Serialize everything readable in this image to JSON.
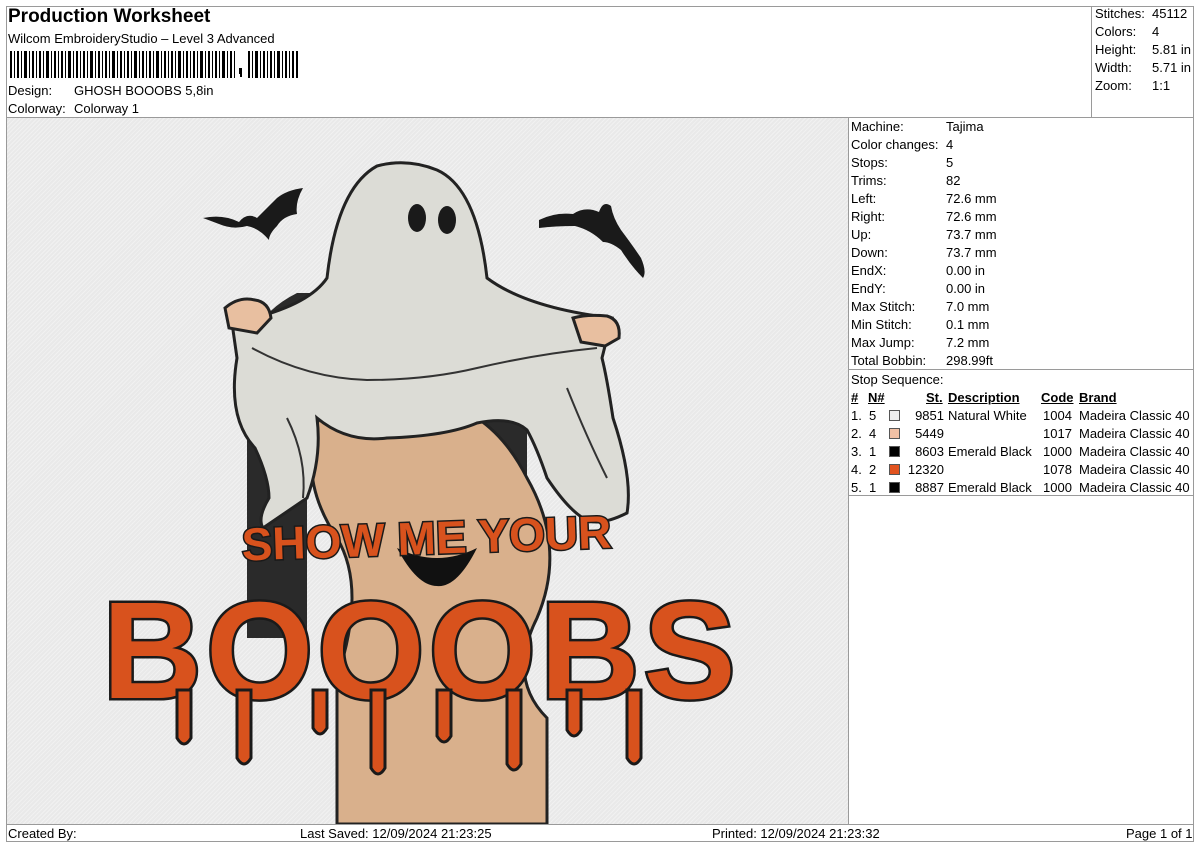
{
  "header": {
    "title": "Production Worksheet",
    "subtitle": "Wilcom EmbroideryStudio – Level 3 Advanced",
    "design_label": "Design:",
    "design_value": "GHOSH BOOOBS  5,8in",
    "colorway_label": "Colorway:",
    "colorway_value": "Colorway 1"
  },
  "stats": [
    {
      "label": "Stitches:",
      "value": "45112"
    },
    {
      "label": "Colors:",
      "value": "4"
    },
    {
      "label": "Height:",
      "value": "5.81 in"
    },
    {
      "label": "Width:",
      "value": "5.71 in"
    },
    {
      "label": "Zoom:",
      "value": "1:1"
    }
  ],
  "machine": [
    {
      "label": "Machine:",
      "value": "Tajima"
    },
    {
      "label": "Color changes:",
      "value": "4"
    },
    {
      "label": "Stops:",
      "value": "5"
    },
    {
      "label": "Trims:",
      "value": "82"
    },
    {
      "label": "Left:",
      "value": "72.6 mm"
    },
    {
      "label": "Right:",
      "value": "72.6 mm"
    },
    {
      "label": "Up:",
      "value": "73.7 mm"
    },
    {
      "label": "Down:",
      "value": "73.7 mm"
    },
    {
      "label": "EndX:",
      "value": "0.00 in"
    },
    {
      "label": "EndY:",
      "value": "0.00 in"
    },
    {
      "label": "Max Stitch:",
      "value": "7.0 mm"
    },
    {
      "label": "Min Stitch:",
      "value": "0.1 mm"
    },
    {
      "label": "Max Jump:",
      "value": "7.2 mm"
    },
    {
      "label": "Total Bobbin:",
      "value": "298.99ft"
    }
  ],
  "stop_sequence": {
    "title": "Stop Sequence:",
    "headers": {
      "idx": "#",
      "n": "N#",
      "st": "St.",
      "desc": "Description",
      "code": "Code",
      "brand": "Brand"
    },
    "rows": [
      {
        "idx": "1.",
        "n": "5",
        "color": "#eeeeee",
        "st": "9851",
        "desc": "Natural White",
        "code": "1004",
        "brand": "Madeira Classic 40"
      },
      {
        "idx": "2.",
        "n": "4",
        "color": "#f2c1a5",
        "st": "5449",
        "desc": "",
        "code": "1017",
        "brand": "Madeira Classic 40"
      },
      {
        "idx": "3.",
        "n": "1",
        "color": "#000000",
        "st": "8603",
        "desc": "Emerald Black",
        "code": "1000",
        "brand": "Madeira Classic 40"
      },
      {
        "idx": "4.",
        "n": "2",
        "color": "#e2531f",
        "st": "12320",
        "desc": "",
        "code": "1078",
        "brand": "Madeira Classic 40"
      },
      {
        "idx": "5.",
        "n": "1",
        "color": "#000000",
        "st": "8887",
        "desc": "Emerald Black",
        "code": "1000",
        "brand": "Madeira Classic 40"
      }
    ]
  },
  "design": {
    "line1": "SHOW ME YOUR",
    "line2": "BOOOBS"
  },
  "footer": {
    "created_by": "Created By:",
    "last_saved": "Last Saved: 12/09/2024 21:23:25",
    "printed": "Printed: 12/09/2024 21:23:32",
    "page": "Page 1 of 1"
  }
}
